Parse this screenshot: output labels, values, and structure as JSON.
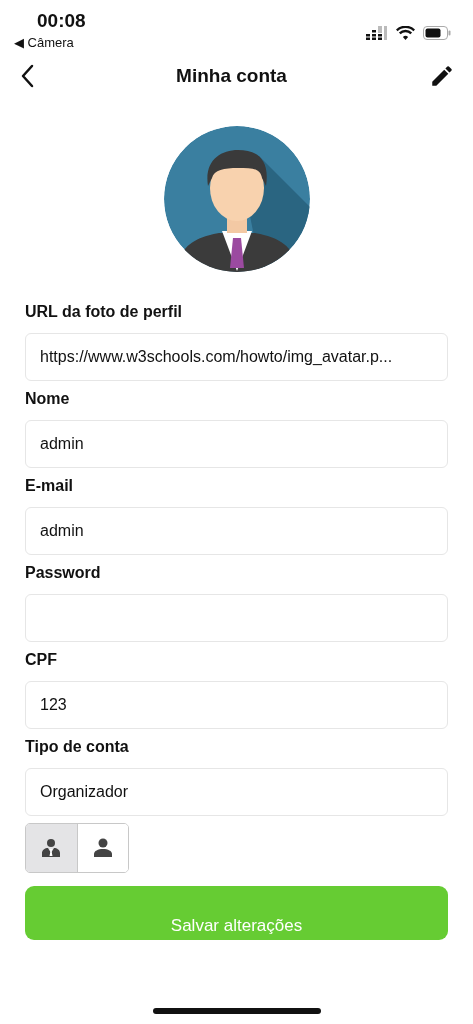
{
  "status_bar": {
    "time": "00:08",
    "back_app": "◀ Câmera"
  },
  "header": {
    "title": "Minha conta"
  },
  "fields": [
    {
      "label": "URL da foto de perfil",
      "value": "https://www.w3schools.com/howto/img_avatar.p..."
    },
    {
      "label": "Nome",
      "value": "admin"
    },
    {
      "label": "E-mail",
      "value": "admin"
    },
    {
      "label": "Password"
    },
    {
      "label": "CPF",
      "value": "123"
    },
    {
      "label": "Tipo de conta",
      "value": "Organizador"
    }
  ],
  "account_type_toggle": [
    {
      "kind": "organizer",
      "selected": true
    },
    {
      "kind": "user",
      "selected": false
    }
  ],
  "save_button": {
    "label": "Salvar alterações"
  }
}
